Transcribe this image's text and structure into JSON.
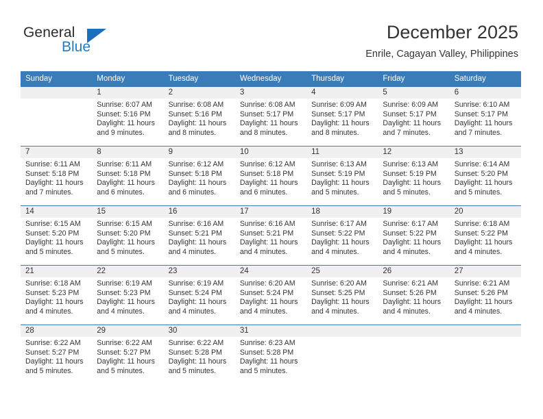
{
  "brand": {
    "name_primary": "General",
    "name_secondary": "Blue",
    "triangle_icon": "blue-triangle-logo-icon"
  },
  "header": {
    "title": "December 2025",
    "location": "Enrile, Cagayan Valley, Philippines"
  },
  "colors": {
    "header_blue": "#3a7cb9",
    "brand_blue": "#2279c4",
    "day_band_gray": "#f0f0f0",
    "text": "#333333"
  },
  "weekdays": [
    "Sunday",
    "Monday",
    "Tuesday",
    "Wednesday",
    "Thursday",
    "Friday",
    "Saturday"
  ],
  "labels": {
    "sunrise_prefix": "Sunrise: ",
    "sunset_prefix": "Sunset: ",
    "daylight_prefix": "Daylight: "
  },
  "weeks": [
    [
      {
        "day": "",
        "sunrise": "",
        "sunset": "",
        "daylight": "",
        "empty": true
      },
      {
        "day": "1",
        "sunrise": "Sunrise: 6:07 AM",
        "sunset": "Sunset: 5:16 PM",
        "daylight": "Daylight: 11 hours and 9 minutes."
      },
      {
        "day": "2",
        "sunrise": "Sunrise: 6:08 AM",
        "sunset": "Sunset: 5:16 PM",
        "daylight": "Daylight: 11 hours and 8 minutes."
      },
      {
        "day": "3",
        "sunrise": "Sunrise: 6:08 AM",
        "sunset": "Sunset: 5:17 PM",
        "daylight": "Daylight: 11 hours and 8 minutes."
      },
      {
        "day": "4",
        "sunrise": "Sunrise: 6:09 AM",
        "sunset": "Sunset: 5:17 PM",
        "daylight": "Daylight: 11 hours and 8 minutes."
      },
      {
        "day": "5",
        "sunrise": "Sunrise: 6:09 AM",
        "sunset": "Sunset: 5:17 PM",
        "daylight": "Daylight: 11 hours and 7 minutes."
      },
      {
        "day": "6",
        "sunrise": "Sunrise: 6:10 AM",
        "sunset": "Sunset: 5:17 PM",
        "daylight": "Daylight: 11 hours and 7 minutes."
      }
    ],
    [
      {
        "day": "7",
        "sunrise": "Sunrise: 6:11 AM",
        "sunset": "Sunset: 5:18 PM",
        "daylight": "Daylight: 11 hours and 7 minutes."
      },
      {
        "day": "8",
        "sunrise": "Sunrise: 6:11 AM",
        "sunset": "Sunset: 5:18 PM",
        "daylight": "Daylight: 11 hours and 6 minutes."
      },
      {
        "day": "9",
        "sunrise": "Sunrise: 6:12 AM",
        "sunset": "Sunset: 5:18 PM",
        "daylight": "Daylight: 11 hours and 6 minutes."
      },
      {
        "day": "10",
        "sunrise": "Sunrise: 6:12 AM",
        "sunset": "Sunset: 5:18 PM",
        "daylight": "Daylight: 11 hours and 6 minutes."
      },
      {
        "day": "11",
        "sunrise": "Sunrise: 6:13 AM",
        "sunset": "Sunset: 5:19 PM",
        "daylight": "Daylight: 11 hours and 5 minutes."
      },
      {
        "day": "12",
        "sunrise": "Sunrise: 6:13 AM",
        "sunset": "Sunset: 5:19 PM",
        "daylight": "Daylight: 11 hours and 5 minutes."
      },
      {
        "day": "13",
        "sunrise": "Sunrise: 6:14 AM",
        "sunset": "Sunset: 5:20 PM",
        "daylight": "Daylight: 11 hours and 5 minutes."
      }
    ],
    [
      {
        "day": "14",
        "sunrise": "Sunrise: 6:15 AM",
        "sunset": "Sunset: 5:20 PM",
        "daylight": "Daylight: 11 hours and 5 minutes."
      },
      {
        "day": "15",
        "sunrise": "Sunrise: 6:15 AM",
        "sunset": "Sunset: 5:20 PM",
        "daylight": "Daylight: 11 hours and 5 minutes."
      },
      {
        "day": "16",
        "sunrise": "Sunrise: 6:16 AM",
        "sunset": "Sunset: 5:21 PM",
        "daylight": "Daylight: 11 hours and 4 minutes."
      },
      {
        "day": "17",
        "sunrise": "Sunrise: 6:16 AM",
        "sunset": "Sunset: 5:21 PM",
        "daylight": "Daylight: 11 hours and 4 minutes."
      },
      {
        "day": "18",
        "sunrise": "Sunrise: 6:17 AM",
        "sunset": "Sunset: 5:22 PM",
        "daylight": "Daylight: 11 hours and 4 minutes."
      },
      {
        "day": "19",
        "sunrise": "Sunrise: 6:17 AM",
        "sunset": "Sunset: 5:22 PM",
        "daylight": "Daylight: 11 hours and 4 minutes."
      },
      {
        "day": "20",
        "sunrise": "Sunrise: 6:18 AM",
        "sunset": "Sunset: 5:22 PM",
        "daylight": "Daylight: 11 hours and 4 minutes."
      }
    ],
    [
      {
        "day": "21",
        "sunrise": "Sunrise: 6:18 AM",
        "sunset": "Sunset: 5:23 PM",
        "daylight": "Daylight: 11 hours and 4 minutes."
      },
      {
        "day": "22",
        "sunrise": "Sunrise: 6:19 AM",
        "sunset": "Sunset: 5:23 PM",
        "daylight": "Daylight: 11 hours and 4 minutes."
      },
      {
        "day": "23",
        "sunrise": "Sunrise: 6:19 AM",
        "sunset": "Sunset: 5:24 PM",
        "daylight": "Daylight: 11 hours and 4 minutes."
      },
      {
        "day": "24",
        "sunrise": "Sunrise: 6:20 AM",
        "sunset": "Sunset: 5:24 PM",
        "daylight": "Daylight: 11 hours and 4 minutes."
      },
      {
        "day": "25",
        "sunrise": "Sunrise: 6:20 AM",
        "sunset": "Sunset: 5:25 PM",
        "daylight": "Daylight: 11 hours and 4 minutes."
      },
      {
        "day": "26",
        "sunrise": "Sunrise: 6:21 AM",
        "sunset": "Sunset: 5:26 PM",
        "daylight": "Daylight: 11 hours and 4 minutes."
      },
      {
        "day": "27",
        "sunrise": "Sunrise: 6:21 AM",
        "sunset": "Sunset: 5:26 PM",
        "daylight": "Daylight: 11 hours and 4 minutes."
      }
    ],
    [
      {
        "day": "28",
        "sunrise": "Sunrise: 6:22 AM",
        "sunset": "Sunset: 5:27 PM",
        "daylight": "Daylight: 11 hours and 5 minutes."
      },
      {
        "day": "29",
        "sunrise": "Sunrise: 6:22 AM",
        "sunset": "Sunset: 5:27 PM",
        "daylight": "Daylight: 11 hours and 5 minutes."
      },
      {
        "day": "30",
        "sunrise": "Sunrise: 6:22 AM",
        "sunset": "Sunset: 5:28 PM",
        "daylight": "Daylight: 11 hours and 5 minutes."
      },
      {
        "day": "31",
        "sunrise": "Sunrise: 6:23 AM",
        "sunset": "Sunset: 5:28 PM",
        "daylight": "Daylight: 11 hours and 5 minutes."
      },
      {
        "day": "",
        "sunrise": "",
        "sunset": "",
        "daylight": "",
        "empty": true
      },
      {
        "day": "",
        "sunrise": "",
        "sunset": "",
        "daylight": "",
        "empty": true
      },
      {
        "day": "",
        "sunrise": "",
        "sunset": "",
        "daylight": "",
        "empty": true
      }
    ]
  ]
}
